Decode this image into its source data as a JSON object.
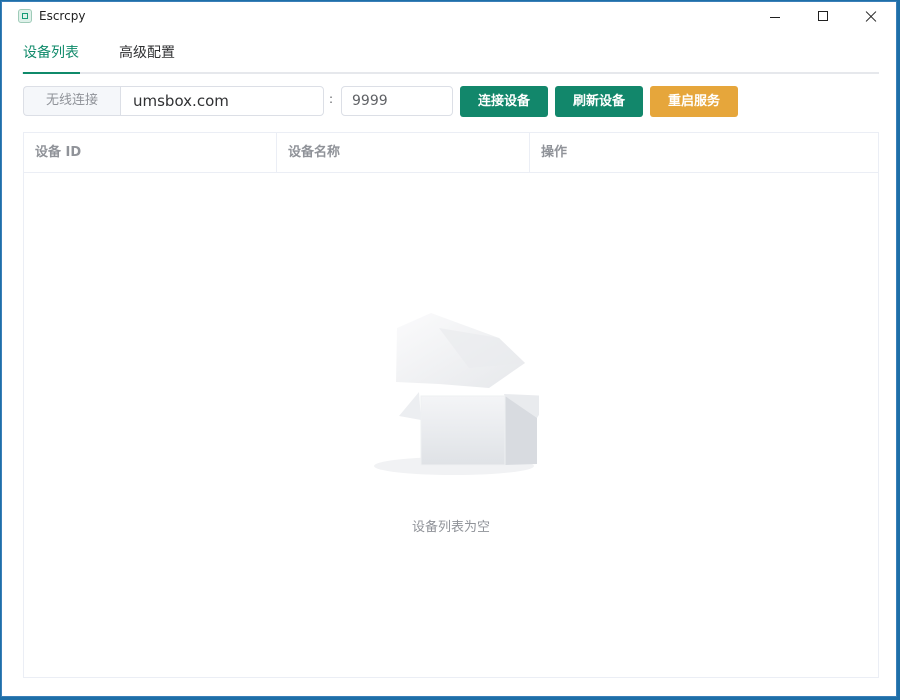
{
  "window": {
    "title": "Escrcpy"
  },
  "tabs": [
    {
      "label": "设备列表",
      "active": true
    },
    {
      "label": "高级配置",
      "active": false
    }
  ],
  "toolbar": {
    "prefix_label": "无线连接",
    "host_value": "umsbox.com",
    "separator": ":",
    "port_value": "9999",
    "connect_label": "连接设备",
    "refresh_label": "刷新设备",
    "restart_label": "重启服务"
  },
  "table": {
    "columns": [
      "设备 ID",
      "设备名称",
      "操作"
    ],
    "rows": [],
    "empty_text": "设备列表为空"
  },
  "colors": {
    "accent": "#0f8a6a",
    "primary_button": "#12876b",
    "warning_button": "#e6a63b"
  }
}
